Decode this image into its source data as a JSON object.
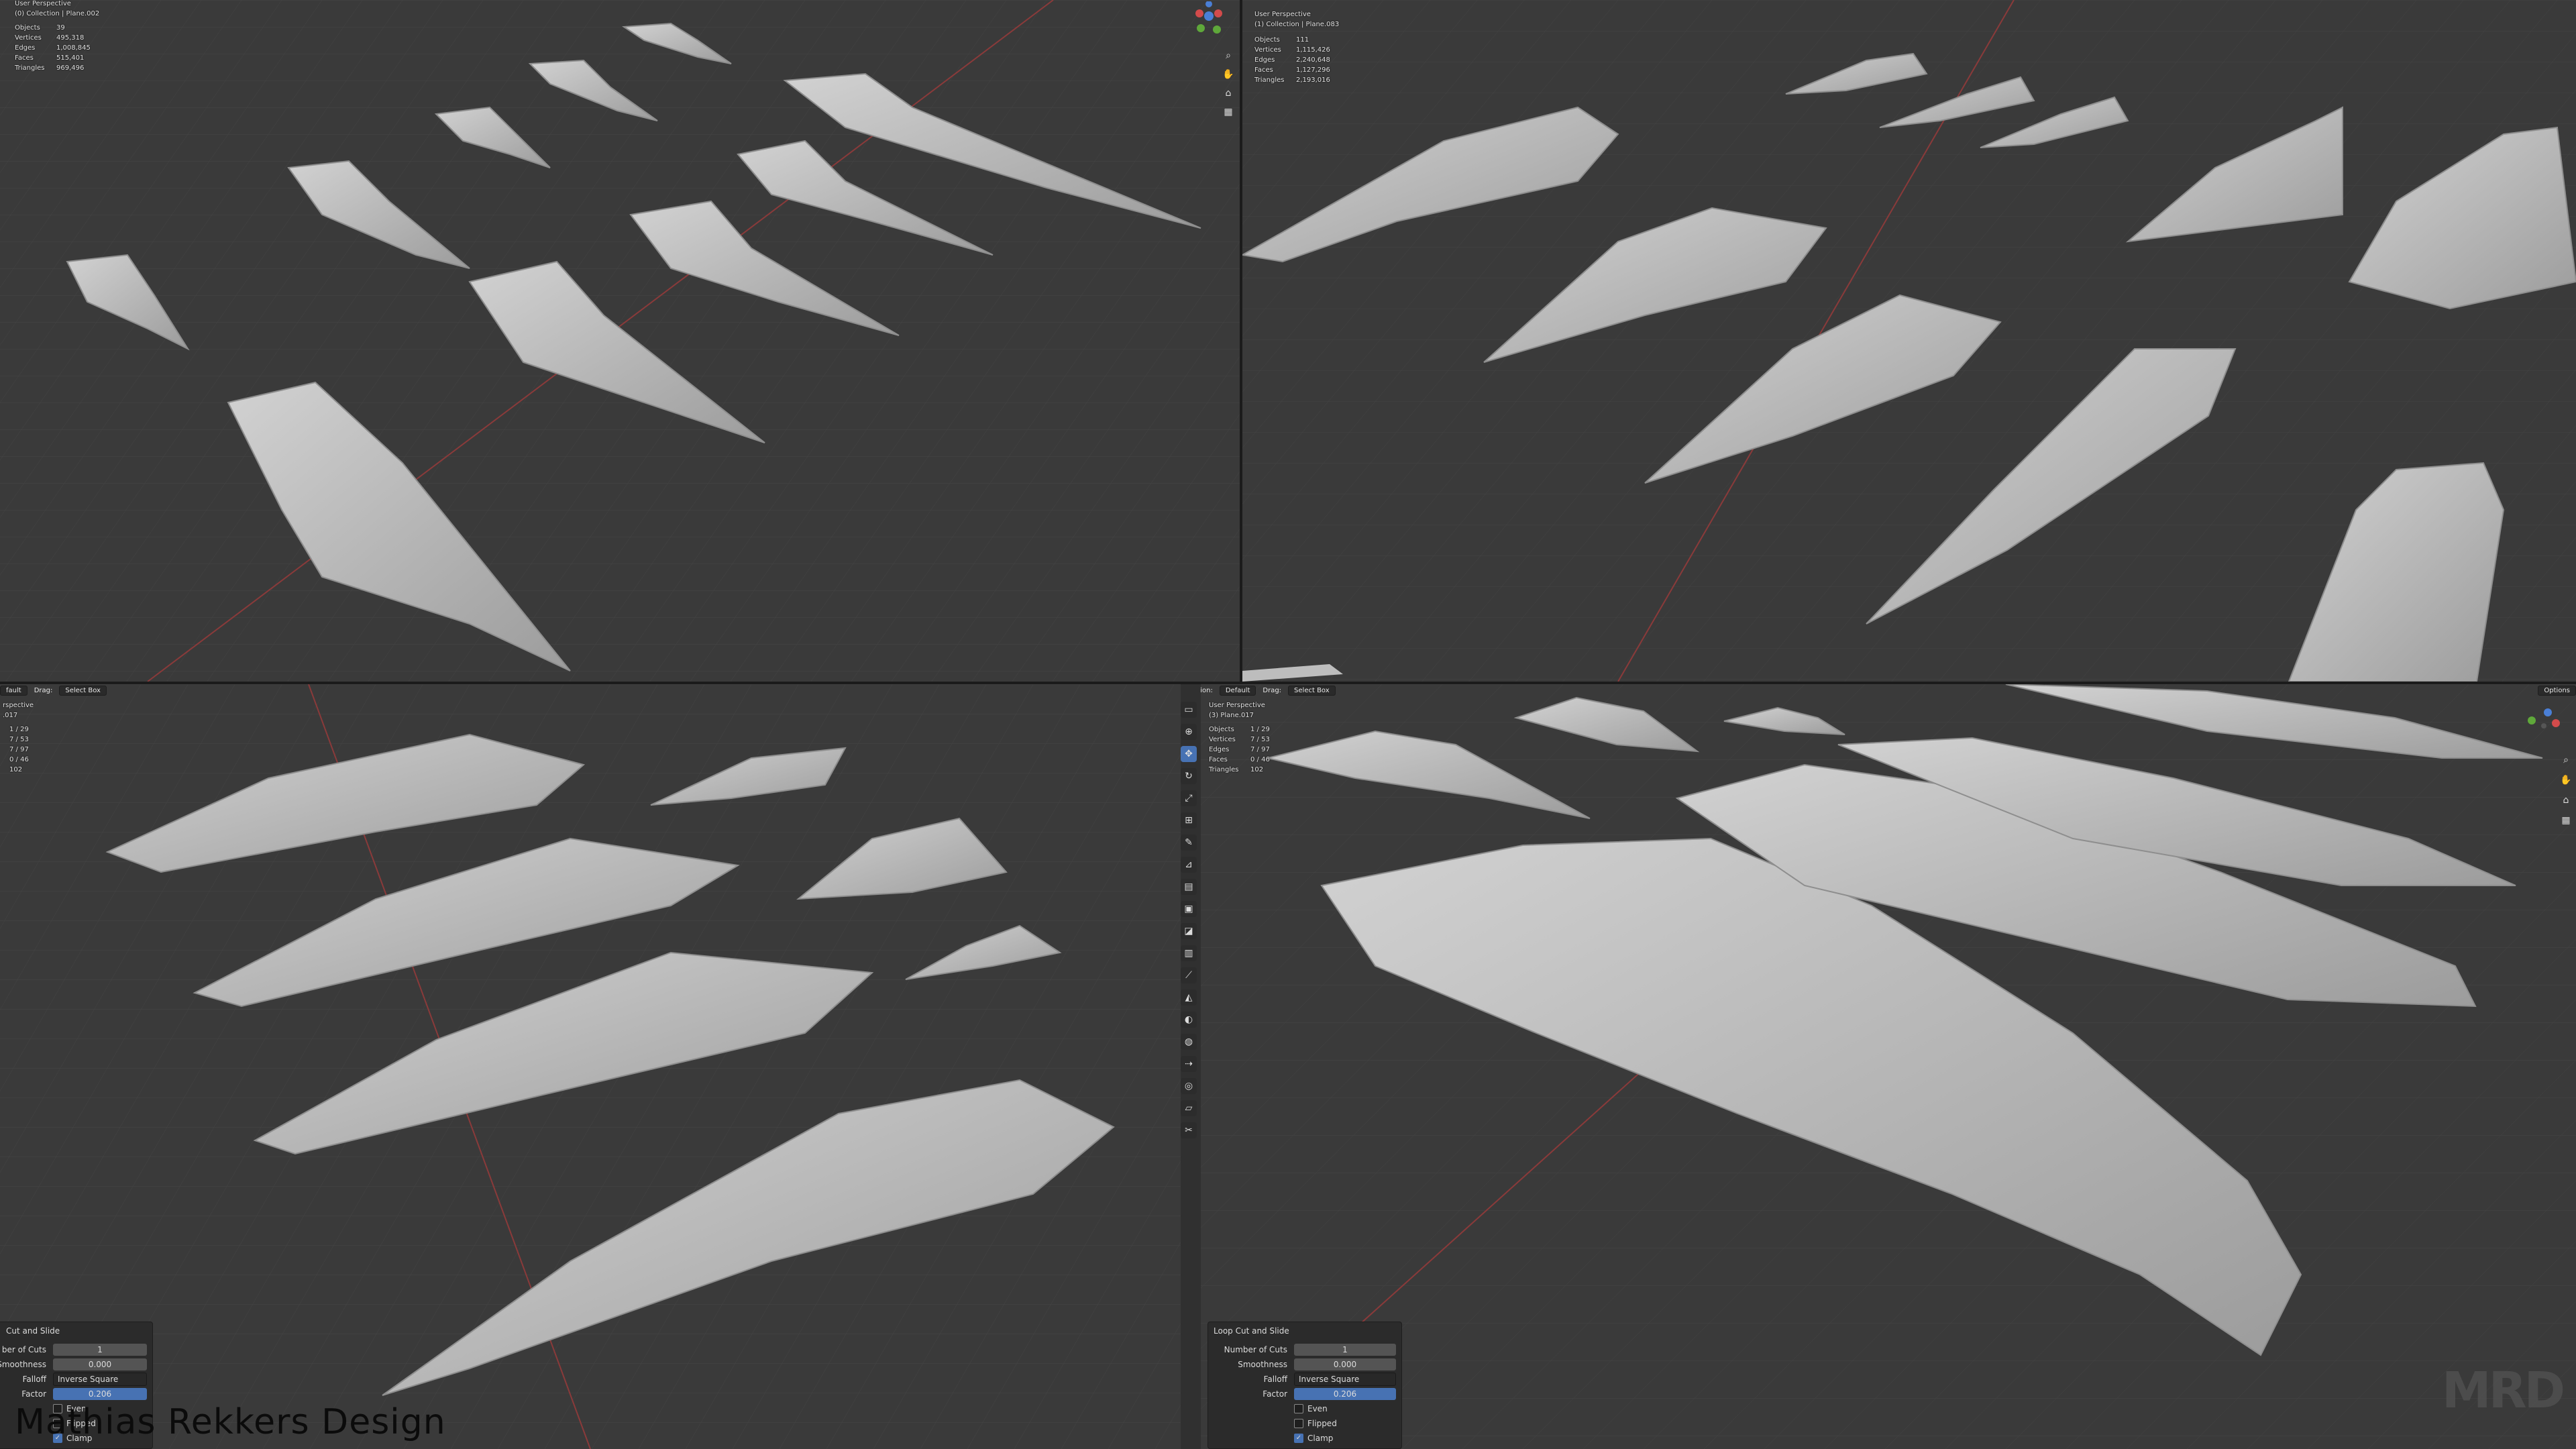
{
  "viewports": {
    "top_left": {
      "title": "User Perspective",
      "subtitle": "(0) Collection | Plane.002",
      "stats": [
        {
          "label": "Objects",
          "value": "39"
        },
        {
          "label": "Vertices",
          "value": "495,318"
        },
        {
          "label": "Edges",
          "value": "1,008,845"
        },
        {
          "label": "Faces",
          "value": "515,401"
        },
        {
          "label": "Triangles",
          "value": "969,496"
        }
      ]
    },
    "top_right": {
      "title": "User Perspective",
      "subtitle": "(1) Collection | Plane.083",
      "stats": [
        {
          "label": "Objects",
          "value": "111"
        },
        {
          "label": "Vertices",
          "value": "1,115,426"
        },
        {
          "label": "Edges",
          "value": "2,240,648"
        },
        {
          "label": "Faces",
          "value": "1,127,296"
        },
        {
          "label": "Triangles",
          "value": "2,193,016"
        }
      ]
    },
    "bottom_left": {
      "title": "rspective",
      "subtitle": ".017",
      "header": {
        "orientation": "fault",
        "drag_label": "Drag:",
        "drag_value": "Select Box"
      },
      "stats": [
        {
          "label": "",
          "value": "1 / 29"
        },
        {
          "label": "",
          "value": "7 / 53"
        },
        {
          "label": "",
          "value": "7 / 97"
        },
        {
          "label": "",
          "value": "0 / 46"
        },
        {
          "label": "",
          "value": "102"
        }
      ]
    },
    "bottom_right": {
      "title": "User Perspective",
      "subtitle": "(3) Plane.017",
      "header": {
        "orientation_label": "ientation:",
        "orientation": "Default",
        "drag_label": "Drag:",
        "drag_value": "Select Box",
        "options": "Options"
      },
      "stats": [
        {
          "label": "Objects",
          "value": "1 / 29"
        },
        {
          "label": "Vertices",
          "value": "7 / 53"
        },
        {
          "label": "Edges",
          "value": "7 / 97"
        },
        {
          "label": "Faces",
          "value": "0 / 46"
        },
        {
          "label": "Triangles",
          "value": "102"
        }
      ]
    }
  },
  "loop_cut_panel_left": {
    "title": "Cut and Slide",
    "rows": [
      {
        "label": "ber of Cuts",
        "value": "1"
      },
      {
        "label": "Smoothness",
        "value": "0.000"
      },
      {
        "label": "Falloff",
        "value": "Inverse Square"
      },
      {
        "label": "Factor",
        "value": "0.206"
      }
    ],
    "checks": [
      {
        "label": "Even",
        "on": false
      },
      {
        "label": "Flipped",
        "on": false
      },
      {
        "label": "Clamp",
        "on": true
      }
    ]
  },
  "loop_cut_panel_right": {
    "title": "Loop Cut and Slide",
    "rows": [
      {
        "label": "Number of Cuts",
        "value": "1"
      },
      {
        "label": "Smoothness",
        "value": "0.000"
      },
      {
        "label": "Falloff",
        "value": "Inverse Square"
      },
      {
        "label": "Factor",
        "value": "0.206"
      }
    ],
    "checks": [
      {
        "label": "Even",
        "on": false
      },
      {
        "label": "Flipped",
        "on": false
      },
      {
        "label": "Clamp",
        "on": true
      }
    ]
  },
  "watermark": "Mathias Rekkers Design",
  "logo": "MRD",
  "colors": {
    "viewport_bg": "#3a3a3a",
    "mesh": "#bdbdbd",
    "accent": "#4772b3",
    "x_axis": "#a33b3b"
  },
  "icons": [
    "gizmo-icon",
    "zoom-icon",
    "hand-icon",
    "camera-icon",
    "grid-icon",
    "select-box-icon",
    "cursor-icon",
    "move-icon",
    "rotate-icon",
    "scale-icon",
    "transform-icon",
    "annotate-icon",
    "measure-icon",
    "extrude-icon",
    "inset-icon",
    "bevel-icon",
    "loop-cut-icon",
    "knife-icon",
    "poly-build-icon",
    "spin-icon",
    "smooth-icon",
    "edge-slide-icon",
    "shrink-icon",
    "shear-icon",
    "rip-icon"
  ]
}
